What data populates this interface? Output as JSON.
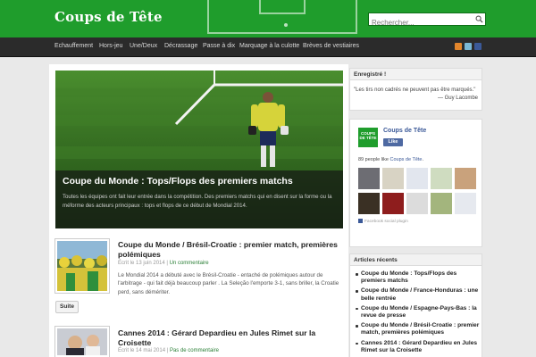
{
  "header": {
    "site_title": "Coups de Tête",
    "search_placeholder": "Rechercher...",
    "search_icon": "search-icon",
    "brand_color": "#1f9d2c"
  },
  "nav": {
    "items": [
      "Echauffement",
      "Hors-jeu",
      "Une/Deux",
      "Décrassage",
      "Passe à dix",
      "Marquage à la culotte",
      "Brèves de vestiaires"
    ],
    "social_icons": [
      "rss-icon",
      "twitter-icon",
      "facebook-icon"
    ]
  },
  "featured": {
    "title": "Coupe du Monde : Tops/Flops des premiers matchs",
    "excerpt": "Toutes les équipes ont fait leur entrée dans la compétition. Des premiers matchs qui en disent sur la forme ou la méforme des acteurs principaux : tops et flops de ce début de Mondial 2014."
  },
  "posts": [
    {
      "title": "Coupe du Monde / Brésil-Croatie : premier match, premières polémiques",
      "meta_date": "Écrit le 13 juin 2014",
      "meta_sep": "|",
      "meta_comments": "Un commentaire",
      "excerpt": "Le Mondial 2014 a débuté avec le Brésil-Croatie - entaché de polémiques autour de l'arbitrage - qui fait déjà beaucoup parler . La Seleção l'emporte 3-1, sans briller, la Croatie perd, sans démériter.",
      "button_label": "Suite"
    },
    {
      "title": "Cannes 2014 : Gérard Depardieu en Jules Rimet sur la Croisette",
      "meta_date": "Écrit le 14 mai 2014",
      "meta_sep": "|",
      "meta_comments": "Pas de commentaire"
    }
  ],
  "sidebar": {
    "registered": {
      "title": "Enregistré !",
      "quote": "\"Les tirs non cadrés ne peuvent pas être marqués.\"",
      "author": "— Guy Lacombe"
    },
    "facebook": {
      "logo_text": "COUPS DE TÊTE",
      "page_name": "Coups de Tête",
      "like_label": "Like",
      "count_prefix": "89 people like",
      "count_link": "Coups de Tête",
      "count_suffix": ".",
      "plugin_text": "Facebook social plugin",
      "face_colors": [
        "#6d6d73",
        "#d8d3c4",
        "#e2e6ee",
        "#cfdcc0",
        "#c9a27c",
        "#3a3024",
        "#8e1d1d",
        "#dcdcdc",
        "#a3b57d",
        "#e6e9ef"
      ]
    },
    "recent": {
      "title": "Articles récents",
      "items": [
        "Coupe du Monde : Tops/Flops des premiers matchs",
        "Coupe du Monde / France-Honduras : une belle rentrée",
        "Coupe du Monde / Espagne-Pays-Bas : la revue de presse",
        "Coupe du Monde / Brésil-Croatie : premier match, premières polémiques",
        "Cannes 2014 : Gérard Depardieu en Jules Rimet sur la Croisette"
      ]
    }
  }
}
